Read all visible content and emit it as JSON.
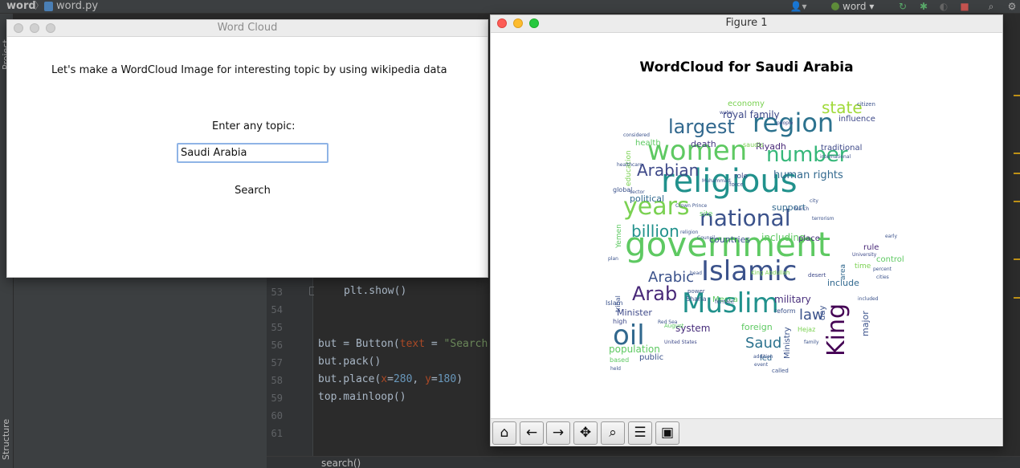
{
  "ide": {
    "project_name": "word",
    "breadcrumb_sep": "〉",
    "file_name": "word.py",
    "run_config": "word",
    "project_tab": "Project",
    "structure_tab": "Structure",
    "function_crumb": "search()",
    "line_numbers": [
      "53",
      "54",
      "55",
      "56",
      "57",
      "58",
      "59",
      "60",
      "61"
    ],
    "code": {
      "l53": "plt.show()",
      "l56_a": "but = Button(",
      "l56_param": "text",
      "l56_eq": " = ",
      "l56_str": "\"Search",
      "l57": "but.pack()",
      "l58_a": "but.place(",
      "l58_x": "x",
      "l58_b": "=",
      "l58_xv": "280",
      "l58_c": ", ",
      "l58_y": "y",
      "l58_d": "=",
      "l58_yv": "180",
      "l58_e": ")",
      "l59": "top.mainloop()"
    }
  },
  "tk_window": {
    "title": "Word Cloud",
    "intro": "Let's make a WordCloud Image for interesting topic by using wikipedia data",
    "prompt": "Enter any topic:",
    "topic_value": "Saudi Arabia",
    "search_label": "Search"
  },
  "figure_window": {
    "title": "Figure 1",
    "plot_title": "WordCloud for Saudi Arabia",
    "toolbar": [
      {
        "icon": "home-icon",
        "glyph": "⌂"
      },
      {
        "icon": "back-arrow-icon",
        "glyph": "←"
      },
      {
        "icon": "forward-arrow-icon",
        "glyph": "→"
      },
      {
        "icon": "pan-icon",
        "glyph": "✥"
      },
      {
        "icon": "zoom-icon",
        "glyph": "⌕"
      },
      {
        "icon": "subplots-config-icon",
        "glyph": "☰"
      },
      {
        "icon": "save-icon",
        "glyph": "▣"
      }
    ]
  },
  "wordcloud": {
    "words": [
      {
        "text": "government",
        "color": "#5ec962"
      },
      {
        "text": "religious",
        "color": "#21918c"
      },
      {
        "text": "Islamic",
        "color": "#3b528b"
      },
      {
        "text": "Muslim",
        "color": "#21918c"
      },
      {
        "text": "women",
        "color": "#5ec962"
      },
      {
        "text": "region",
        "color": "#2c728e"
      },
      {
        "text": "national",
        "color": "#3b528b"
      },
      {
        "text": "years",
        "color": "#7ad151"
      },
      {
        "text": "number",
        "color": "#35b779"
      },
      {
        "text": "largest",
        "color": "#31688e"
      },
      {
        "text": "King",
        "color": "#440154"
      },
      {
        "text": "oil",
        "color": "#31688e"
      },
      {
        "text": "Arab",
        "color": "#482878"
      },
      {
        "text": "Arabian",
        "color": "#3e4989"
      },
      {
        "text": "billion",
        "color": "#21918c"
      },
      {
        "text": "Arabic",
        "color": "#3b528b"
      },
      {
        "text": "Saud",
        "color": "#2c728e"
      },
      {
        "text": "state",
        "color": "#a0da39"
      },
      {
        "text": "law",
        "color": "#3b528b"
      },
      {
        "text": "human rights",
        "color": "#31688e"
      },
      {
        "text": "royal family",
        "color": "#3e4989"
      },
      {
        "text": "population",
        "color": "#5ec962"
      },
      {
        "text": "military",
        "color": "#472d7b"
      },
      {
        "text": "system",
        "color": "#472d7b"
      },
      {
        "text": "including",
        "color": "#5ec962"
      },
      {
        "text": "countries",
        "color": "#3b528b"
      },
      {
        "text": "Riyadh",
        "color": "#482878"
      },
      {
        "text": "political",
        "color": "#31688e"
      },
      {
        "text": "death",
        "color": "#443983"
      },
      {
        "text": "traditional",
        "color": "#3e4989"
      },
      {
        "text": "support",
        "color": "#31688e"
      },
      {
        "text": "foreign",
        "color": "#5ec962"
      },
      {
        "text": "major",
        "color": "#3b528b"
      },
      {
        "text": "influence",
        "color": "#3e4989"
      },
      {
        "text": "economy",
        "color": "#7ad151"
      },
      {
        "text": "health",
        "color": "#5ec962"
      },
      {
        "text": "Minister",
        "color": "#3e4989"
      },
      {
        "text": "include",
        "color": "#31688e"
      },
      {
        "text": "public",
        "color": "#3b528b"
      },
      {
        "text": "led",
        "color": "#31688e"
      },
      {
        "text": "rule",
        "color": "#482878"
      },
      {
        "text": "place",
        "color": "#472d7b"
      },
      {
        "text": "Mecca",
        "color": "#5ec962"
      },
      {
        "text": "Sharia",
        "color": "#3b528b"
      },
      {
        "text": "reform",
        "color": "#3b528b"
      },
      {
        "text": "education",
        "color": "#7ad151"
      },
      {
        "text": "Crown Prince",
        "color": "#3b528b"
      },
      {
        "text": "University",
        "color": "#3e4989"
      },
      {
        "text": "control",
        "color": "#5ec962"
      },
      {
        "text": "global",
        "color": "#3b528b"
      },
      {
        "text": "water",
        "color": "#3e4989"
      },
      {
        "text": "Yemen",
        "color": "#5ec962"
      },
      {
        "text": "Ministry",
        "color": "#3b528b"
      },
      {
        "text": "day",
        "color": "#3b528b"
      },
      {
        "text": "area",
        "color": "#31688e"
      },
      {
        "text": "called",
        "color": "#3b528b"
      },
      {
        "text": "site",
        "color": "#5ec962"
      },
      {
        "text": "role",
        "color": "#3e4989"
      },
      {
        "text": "terrorism",
        "color": "#3b528b"
      },
      {
        "text": "international",
        "color": "#3b528b"
      },
      {
        "text": "citizen",
        "color": "#3b528b"
      },
      {
        "text": "United States",
        "color": "#3e4989"
      },
      {
        "text": "female",
        "color": "#3b528b"
      },
      {
        "text": "power",
        "color": "#3b528b"
      },
      {
        "text": "tribal",
        "color": "#3b528b"
      },
      {
        "text": "desert",
        "color": "#3e4989"
      },
      {
        "text": "cities",
        "color": "#3b528b"
      },
      {
        "text": "Hejaz",
        "color": "#7ad151"
      },
      {
        "text": "high",
        "color": "#3e4989"
      },
      {
        "text": "Islam",
        "color": "#3b528b"
      },
      {
        "text": "force",
        "color": "#3b528b"
      },
      {
        "text": "Muhammad",
        "color": "#3b528b"
      },
      {
        "text": "saudis",
        "color": "#7ad151"
      },
      {
        "text": "people",
        "color": "#3e4989"
      },
      {
        "text": "family",
        "color": "#3b528b"
      },
      {
        "text": "percent",
        "color": "#3b528b"
      },
      {
        "text": "head",
        "color": "#3b528b"
      },
      {
        "text": "King Abdullah",
        "color": "#7ad151"
      },
      {
        "text": "Red Sea",
        "color": "#3b528b"
      },
      {
        "text": "August",
        "color": "#5ec962"
      },
      {
        "text": "based",
        "color": "#5ec962"
      },
      {
        "text": "held",
        "color": "#3b528b"
      },
      {
        "text": "plan",
        "color": "#3b528b"
      },
      {
        "text": "sector",
        "color": "#3b528b"
      },
      {
        "text": "healthcare",
        "color": "#3b528b"
      },
      {
        "text": "considered",
        "color": "#3b528b"
      },
      {
        "text": "city",
        "color": "#3b528b"
      },
      {
        "text": "March",
        "color": "#3b528b"
      },
      {
        "text": "religion",
        "color": "#3b528b"
      },
      {
        "text": "Council",
        "color": "#3b528b"
      },
      {
        "text": "time",
        "color": "#7ad151"
      },
      {
        "text": "early",
        "color": "#3b528b"
      },
      {
        "text": "included",
        "color": "#3b528b"
      },
      {
        "text": "event",
        "color": "#3b528b"
      },
      {
        "text": "addition",
        "color": "#3b528b"
      }
    ]
  }
}
